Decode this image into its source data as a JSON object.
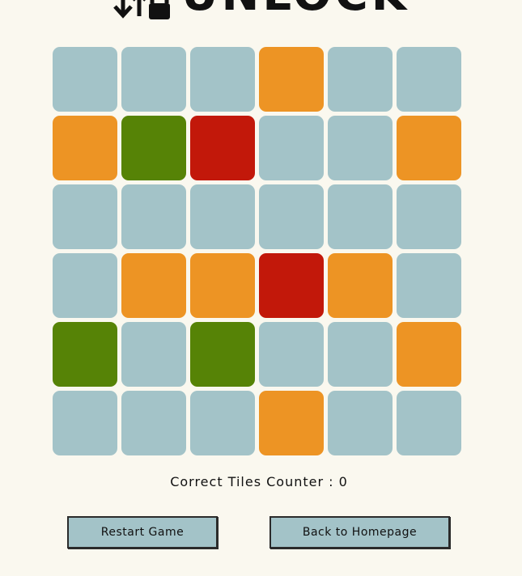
{
  "header": {
    "title": "UNLOCK",
    "icon": "arrows-lock-icon"
  },
  "colors": {
    "background": "#faf8ef",
    "grey": "#a3c3c8",
    "orange": "#ed9424",
    "green": "#568306",
    "red": "#c2180a"
  },
  "board": {
    "rows": [
      [
        "grey",
        "grey",
        "grey",
        "orange",
        "grey",
        "grey"
      ],
      [
        "orange",
        "green",
        "red",
        "grey",
        "grey",
        "orange"
      ],
      [
        "grey",
        "grey",
        "grey",
        "grey",
        "grey",
        "grey"
      ],
      [
        "grey",
        "orange",
        "orange",
        "red",
        "orange",
        "grey"
      ],
      [
        "green",
        "grey",
        "green",
        "grey",
        "grey",
        "orange"
      ],
      [
        "grey",
        "grey",
        "grey",
        "orange",
        "grey",
        "grey"
      ]
    ]
  },
  "status": {
    "counter_text": "Correct Tiles Counter : 0"
  },
  "actions": {
    "restart_label": "Restart Game",
    "home_label": "Back to Homepage"
  }
}
